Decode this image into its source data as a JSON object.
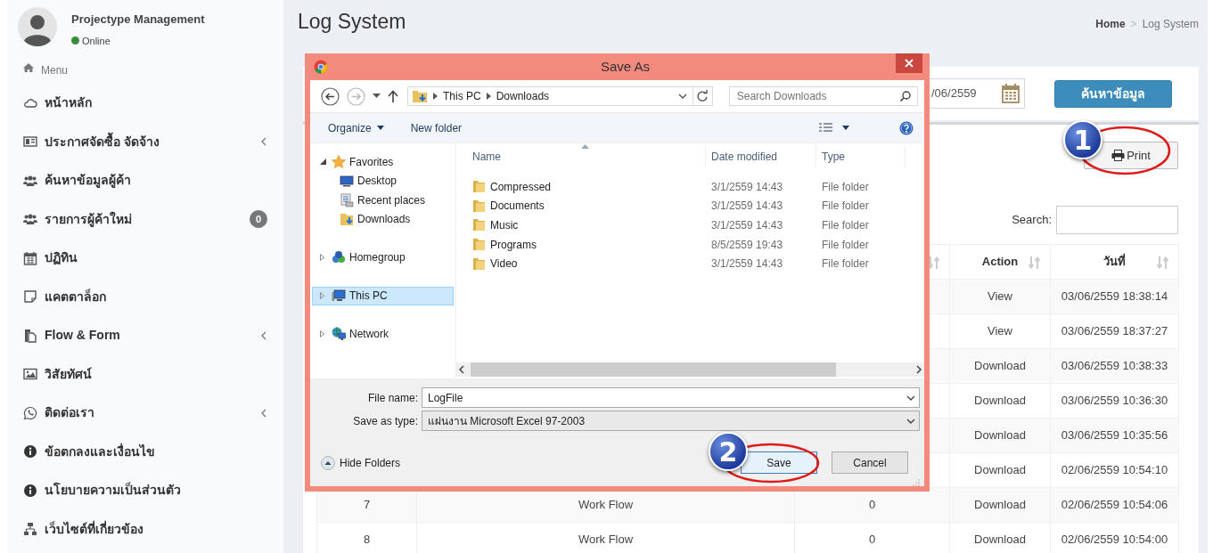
{
  "sidebar": {
    "user": {
      "name": "Projectype Management",
      "status": "Online",
      "online": true
    },
    "menu_header": "Menu",
    "items": [
      {
        "label": "หน้าหลัก",
        "has_submenu": false
      },
      {
        "label": "ประกาศจัดซื้อ จัดจ้าง",
        "has_submenu": true
      },
      {
        "label": "ค้นหาข้อมูลผู้ค้า",
        "has_submenu": false
      },
      {
        "label": "รายการผู้ค้าใหม่",
        "has_submenu": false,
        "badge": "0"
      },
      {
        "label": "ปฏิทิน",
        "has_submenu": false
      },
      {
        "label": "แคตตาล็อก",
        "has_submenu": false
      },
      {
        "label": "Flow & Form",
        "has_submenu": true
      },
      {
        "label": "วิสัยทัศน์",
        "has_submenu": false
      },
      {
        "label": "ติดต่อเรา",
        "has_submenu": true
      },
      {
        "label": "ข้อตกลงและเงื่อนไข",
        "has_submenu": false
      },
      {
        "label": "นโยบายความเป็นส่วนตัว",
        "has_submenu": false
      },
      {
        "label": "เว็บไซต์ที่เกี่ยวข้อง",
        "has_submenu": false
      }
    ]
  },
  "page": {
    "title": "Log System",
    "breadcrumb_separator": ">",
    "breadcrumb": [
      {
        "label": "Home",
        "current": false
      },
      {
        "label": "Log System",
        "current": true
      }
    ]
  },
  "filter": {
    "date_value": "/06/2559",
    "search_button": "ค้นหาข้อมูล"
  },
  "print_button": "Print",
  "search_label": "Search:",
  "table": {
    "columns": [
      "Action",
      "วันที่"
    ],
    "rows": [
      {
        "action": "View",
        "date": "03/06/2559 18:38:14"
      },
      {
        "action": "View",
        "date": "03/06/2559 18:37:27"
      },
      {
        "action": "Download",
        "date": "03/06/2559 10:38:33"
      },
      {
        "action": "Download",
        "date": "03/06/2559 10:36:30"
      },
      {
        "action": "Download",
        "date": "03/06/2559 10:35:56"
      },
      {
        "action": "Download",
        "date": "02/06/2559 10:54:10"
      },
      {
        "number": "7",
        "module": "Work Flow",
        "count": "0",
        "action": "Download",
        "date": "02/06/2559 10:54:06"
      },
      {
        "number": "8",
        "module": "Work Flow",
        "count": "0",
        "action": "Download",
        "date": "02/06/2559 10:54:00"
      }
    ]
  },
  "dialog": {
    "title": "Save As",
    "forward_disabled": true,
    "path": [
      "This PC",
      "Downloads"
    ],
    "search_placeholder": "Search Downloads",
    "toolbar": [
      "Organize",
      "New folder"
    ],
    "tree": [
      {
        "label": "Favorites",
        "expanded": true,
        "selected": false,
        "children": [
          {
            "label": "Desktop",
            "selected": false
          },
          {
            "label": "Recent places",
            "selected": false
          },
          {
            "label": "Downloads",
            "selected": false
          }
        ]
      },
      {
        "label": "Homegroup",
        "expanded": false,
        "selected": false
      },
      {
        "label": "This PC",
        "expanded": false,
        "selected": true
      },
      {
        "label": "Network",
        "expanded": false,
        "selected": false
      }
    ],
    "columns": [
      "Name",
      "Date modified",
      "Type"
    ],
    "files": [
      {
        "name": "Compressed",
        "date": "3/1/2559 14:43",
        "type": "File folder"
      },
      {
        "name": "Documents",
        "date": "3/1/2559 14:43",
        "type": "File folder"
      },
      {
        "name": "Music",
        "date": "3/1/2559 14:43",
        "type": "File folder"
      },
      {
        "name": "Programs",
        "date": "8/5/2559 19:43",
        "type": "File folder"
      },
      {
        "name": "Video",
        "date": "3/1/2559 14:43",
        "type": "File folder"
      }
    ],
    "file_name_label": "File name:",
    "file_name": "LogFile",
    "type_label": "Save as type:",
    "file_type": "แผ่นงาน Microsoft Excel 97-2003",
    "hide_folders": "Hide Folders",
    "buttons": [
      {
        "label": "Save",
        "focused": true
      },
      {
        "label": "Cancel",
        "focused": false
      }
    ]
  },
  "callouts": [
    {
      "number": "1"
    },
    {
      "number": "2"
    }
  ]
}
